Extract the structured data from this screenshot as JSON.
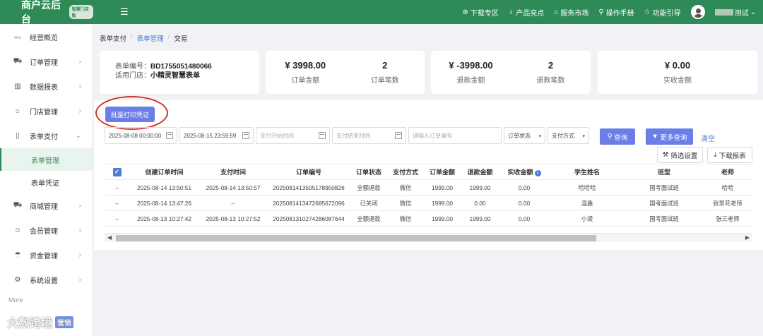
{
  "brand": {
    "title": "商户云后台",
    "badge": "智慧门店版"
  },
  "topnav": [
    {
      "label": "下载专区",
      "icon": "download-icon"
    },
    {
      "label": "产品亮点",
      "icon": "lightbulb-icon"
    },
    {
      "label": "服务市场",
      "icon": "store-icon"
    },
    {
      "label": "操作手册",
      "icon": "search-icon"
    },
    {
      "label": "功能引导",
      "icon": "star-icon"
    }
  ],
  "user": {
    "name_suffix": "测试"
  },
  "sidebar": {
    "items": [
      {
        "label": "经营概览",
        "icon": "trend-icon",
        "arrow": ""
      },
      {
        "label": "订单管理",
        "icon": "cart-icon",
        "arrow": "›"
      },
      {
        "label": "数据报表",
        "icon": "bar-chart-icon",
        "arrow": "›"
      },
      {
        "label": "门店管理",
        "icon": "home-icon",
        "arrow": "›"
      },
      {
        "label": "表单支付",
        "icon": "bookmark-icon",
        "arrow": "⌄"
      }
    ],
    "sub": [
      {
        "label": "表单管理",
        "active": true
      },
      {
        "label": "表单凭证",
        "active": false
      }
    ],
    "items2": [
      {
        "label": "商城管理",
        "icon": "shop-cart-icon",
        "arrow": "›"
      },
      {
        "label": "会员管理",
        "icon": "smile-icon",
        "arrow": "›"
      },
      {
        "label": "资金管理",
        "icon": "umbrella-icon",
        "arrow": "›"
      },
      {
        "label": "系统设置",
        "icon": "gear-icon",
        "arrow": "›"
      }
    ],
    "more": "More"
  },
  "watermark": {
    "text": "大数跨境",
    "tag": "营销"
  },
  "breadcrumb": {
    "a": "表单支付",
    "b": "表单管理",
    "c": "交易"
  },
  "info": {
    "no_label": "表单编号：",
    "no_value": "BD1755051480066",
    "store_label": "适用门店：",
    "store_value": "小精灵智慧表单"
  },
  "stats": [
    {
      "value": "¥ 3998.00",
      "label": "订单金额"
    },
    {
      "value": "2",
      "label": "订单笔数"
    },
    {
      "value": "¥ -3998.00",
      "label": "退款金额"
    },
    {
      "value": "2",
      "label": "退款笔数"
    },
    {
      "value": "¥ 0.00",
      "label": "实收金额"
    }
  ],
  "actions": {
    "batch_print": "批量打印凭证",
    "query": "查询",
    "more_query": "更多查询",
    "clear": "清空",
    "filter_settings": "筛选设置",
    "download_report": "下载报表"
  },
  "filters": {
    "start_date": "2025-08-08 00:00:00",
    "end_date": "2025-08-15 23:59:59",
    "pay_start_placeholder": "支付开始时间",
    "pay_end_placeholder": "支付结束时间",
    "order_no_placeholder": "请输入订单编号",
    "order_status": "订单状态",
    "pay_method": "支付方式"
  },
  "table": {
    "headers": [
      "创建订单时间",
      "支付时间",
      "订单编号",
      "订单状态",
      "支付方式",
      "订单金额",
      "退款金额",
      "实收金额",
      "学生姓名",
      "班型",
      "老师"
    ],
    "rows": [
      [
        "--",
        "2025-08-14 13:50:51",
        "2025-08-14 13:50:57",
        "20250814135051789508​26",
        "全额退款",
        "微信",
        "1999.00",
        "1999.00",
        "0.00",
        "哈哈哈",
        "国考面试班",
        "哈哈"
      ],
      [
        "--",
        "2025-08-14 13:47:26",
        "--",
        "20250814134726856720​96",
        "已关闭",
        "微信",
        "1999.00",
        "0.00",
        "0.00",
        "温鑫",
        "国考面试班",
        "张翠花老师"
      ],
      [
        "--",
        "2025-08-13 10:27:42",
        "2025-08-13 10:27:52",
        "20250813102742860876​44",
        "全额退款",
        "微信",
        "1999.00",
        "1999.00",
        "0.00",
        "小梁",
        "国考面试班",
        "张三老师"
      ]
    ]
  },
  "colors": {
    "brand": "#2e8b57",
    "primary": "#6b7ee8",
    "link": "#4a7bd0",
    "annotation": "#d0352c"
  }
}
